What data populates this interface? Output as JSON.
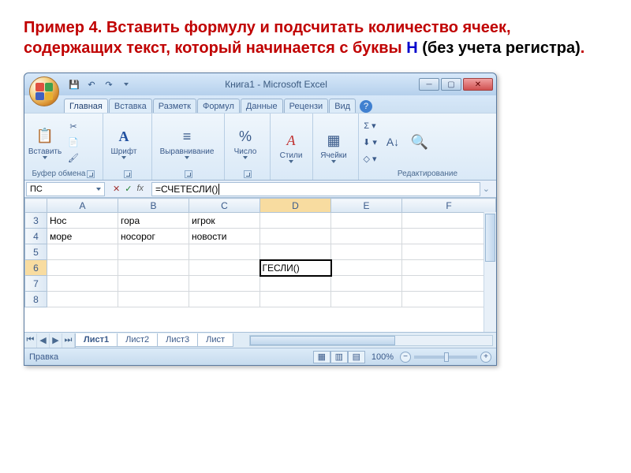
{
  "heading": {
    "part1": "Пример 4. Вставить формулу и подсчитать количество ячеек, содержащих текст, который начинается с буквы ",
    "letter": "Н",
    "part2": "  (без учета регистра)",
    "dot": "."
  },
  "titlebar": {
    "title": "Книга1 - Microsoft Excel"
  },
  "tabs": [
    "Главная",
    "Вставка",
    "Разметк",
    "Формул",
    "Данные",
    "Рецензи",
    "Вид"
  ],
  "ribbon": {
    "paste": "Вставить",
    "clipboard": "Буфер обмена",
    "font": "Шрифт",
    "align": "Выравнивание",
    "number": "Число",
    "styles": "Стили",
    "cells": "Ячейки",
    "editing": "Редактирование"
  },
  "namebox": "ПС",
  "formula": "=СЧЕТЕСЛИ()",
  "columns": [
    "A",
    "B",
    "C",
    "D",
    "E",
    "F"
  ],
  "rows": [
    "3",
    "4",
    "5",
    "6",
    "7",
    "8"
  ],
  "cells": {
    "A3": "Нос",
    "B3": "гора",
    "C3": "игрок",
    "A4": "море",
    "B4": "носорог",
    "C4": "новости",
    "D6": "ГЕСЛИ()"
  },
  "sheets": [
    "Лист1",
    "Лист2",
    "Лист3",
    "Лист"
  ],
  "status": "Правка",
  "zoom": "100%"
}
